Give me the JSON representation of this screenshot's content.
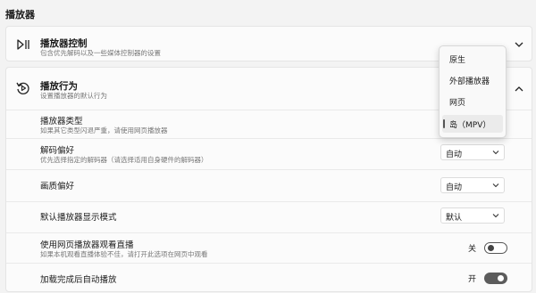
{
  "section": {
    "title": "播放器"
  },
  "player_control": {
    "title": "播放器控制",
    "desc": "包含优先解码以及一些媒体控制器的设置",
    "icon": "play-pause-icon"
  },
  "player_behavior": {
    "title": "播放行为",
    "desc": "设置播放器的默认行为",
    "icon": "replay-icon",
    "rows": {
      "player_type": {
        "label": "播放器类型",
        "desc": "如果其它类型闪退严重，请使用网页播放器"
      },
      "decode_pref": {
        "label": "解码偏好",
        "desc": "优先选择指定的解码器（请选择适用自身硬件的解码器）",
        "value": "自动"
      },
      "quality_pref": {
        "label": "画质偏好",
        "value": "自动"
      },
      "display_mode": {
        "label": "默认播放器显示模式",
        "value": "默认"
      },
      "web_live": {
        "label": "使用网页播放器观看直播",
        "desc": "如果本机观看直播体验不佳，请打开此选项在网页中观看",
        "state_label": "关",
        "on": false
      },
      "autoplay": {
        "label": "加载完成后自动播放",
        "state_label": "开",
        "on": true
      }
    }
  },
  "player_type_dropdown": {
    "options": [
      "原生",
      "外部播放器",
      "网页",
      "岛（MPV）"
    ],
    "selected_index": 3
  }
}
